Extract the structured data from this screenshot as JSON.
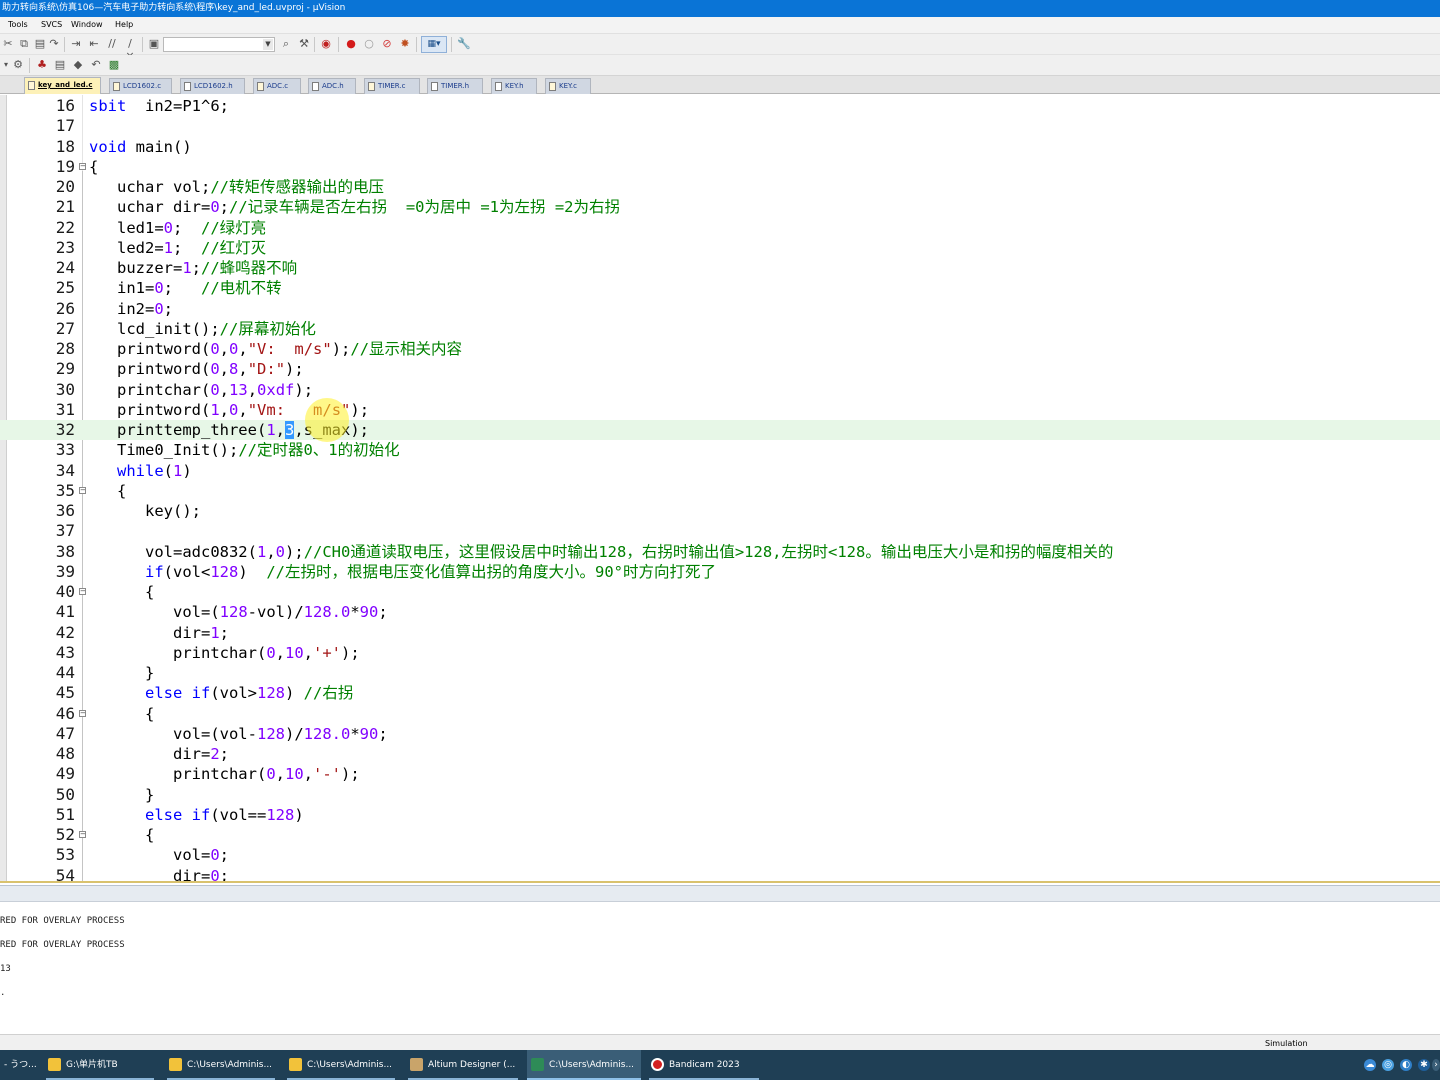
{
  "window": {
    "title": "助力转向系统\\仿真106—汽车电子助力转向系统\\程序\\key_and_led.uvproj - µVision"
  },
  "menu": [
    "Tools",
    "SVCS",
    "Window",
    "Help"
  ],
  "toolbar": {
    "icons": [
      "cut-icon",
      "copy-icon",
      "paste-icon",
      "indent-icon",
      "unindent-icon",
      "comment-icon",
      "uncomment-icon",
      "open-icon",
      "find-icon",
      "debug-icon",
      "breakpoint-icon",
      "insert-breakpoint-icon",
      "kill-breakpoints-icon",
      "target-icon",
      "configure-icon"
    ],
    "target_combo_value": ""
  },
  "tabs": [
    {
      "label": "key_and_led.c",
      "active": true
    },
    {
      "label": "LCD1602.c",
      "active": false
    },
    {
      "label": "LCD1602.h",
      "active": false
    },
    {
      "label": "ADC.c",
      "active": false
    },
    {
      "label": "ADC.h",
      "active": false
    },
    {
      "label": "TIMER.c",
      "active": false
    },
    {
      "label": "TIMER.h",
      "active": false
    },
    {
      "label": "KEY.h",
      "active": false
    },
    {
      "label": "KEY.c",
      "active": false
    }
  ],
  "editor": {
    "current_line": 32,
    "lines": [
      {
        "n": "16",
        "segs": [
          [
            "kw",
            "sbit"
          ],
          [
            "",
            "  in2=P1^6;"
          ]
        ]
      },
      {
        "n": "17",
        "segs": []
      },
      {
        "n": "18",
        "segs": [
          [
            "kw",
            "void"
          ],
          [
            "",
            " main()"
          ]
        ]
      },
      {
        "n": "19",
        "fold": "open",
        "segs": [
          [
            "",
            "{"
          ]
        ]
      },
      {
        "n": "20",
        "segs": [
          [
            "",
            "   uchar vol;"
          ],
          [
            "cm",
            "//转矩传感器输出的电压"
          ]
        ]
      },
      {
        "n": "21",
        "segs": [
          [
            "",
            "   uchar dir="
          ],
          [
            "num",
            "0"
          ],
          [
            "",
            ";"
          ],
          [
            "cm",
            "//记录车辆是否左右拐  =0为居中 =1为左拐 =2为右拐"
          ]
        ]
      },
      {
        "n": "22",
        "segs": [
          [
            "",
            "   led1="
          ],
          [
            "num",
            "0"
          ],
          [
            "",
            ";  "
          ],
          [
            "cm",
            "//绿灯亮"
          ]
        ]
      },
      {
        "n": "23",
        "segs": [
          [
            "",
            "   led2="
          ],
          [
            "num",
            "1"
          ],
          [
            "",
            ";  "
          ],
          [
            "cm",
            "//红灯灭"
          ]
        ]
      },
      {
        "n": "24",
        "segs": [
          [
            "",
            "   buzzer="
          ],
          [
            "num",
            "1"
          ],
          [
            "",
            ";"
          ],
          [
            "cm",
            "//蜂鸣器不响"
          ]
        ]
      },
      {
        "n": "25",
        "segs": [
          [
            "",
            "   in1="
          ],
          [
            "num",
            "0"
          ],
          [
            "",
            ";   "
          ],
          [
            "cm",
            "//电机不转"
          ]
        ]
      },
      {
        "n": "26",
        "segs": [
          [
            "",
            "   in2="
          ],
          [
            "num",
            "0"
          ],
          [
            "",
            ";"
          ]
        ]
      },
      {
        "n": "27",
        "segs": [
          [
            "",
            "   lcd_init();"
          ],
          [
            "cm",
            "//屏幕初始化"
          ]
        ]
      },
      {
        "n": "28",
        "segs": [
          [
            "",
            "   printword("
          ],
          [
            "num",
            "0"
          ],
          [
            "",
            ","
          ],
          [
            "num",
            "0"
          ],
          [
            "",
            ","
          ],
          [
            "str",
            "\"V:  m/s\""
          ],
          [
            "",
            ");"
          ],
          [
            "cm",
            "//显示相关内容"
          ]
        ]
      },
      {
        "n": "29",
        "segs": [
          [
            "",
            "   printword("
          ],
          [
            "num",
            "0"
          ],
          [
            "",
            ","
          ],
          [
            "num",
            "8"
          ],
          [
            "",
            ","
          ],
          [
            "str",
            "\"D:\""
          ],
          [
            "",
            ");"
          ]
        ]
      },
      {
        "n": "30",
        "segs": [
          [
            "",
            "   printchar("
          ],
          [
            "num",
            "0"
          ],
          [
            "",
            ","
          ],
          [
            "num",
            "13"
          ],
          [
            "",
            ","
          ],
          [
            "num",
            "0xdf"
          ],
          [
            "",
            ");"
          ]
        ]
      },
      {
        "n": "31",
        "segs": [
          [
            "",
            "   printword("
          ],
          [
            "num",
            "1"
          ],
          [
            "",
            ","
          ],
          [
            "num",
            "0"
          ],
          [
            "",
            ","
          ],
          [
            "str",
            "\"Vm:   m/s\""
          ],
          [
            "",
            ");"
          ]
        ]
      },
      {
        "n": "32",
        "segs": [
          [
            "",
            "   printtemp_three("
          ],
          [
            "num",
            "1"
          ],
          [
            "",
            ","
          ],
          [
            "sel",
            "3"
          ],
          [
            "",
            ",s_max);"
          ]
        ]
      },
      {
        "n": "33",
        "segs": [
          [
            "",
            "   Time0_Init();"
          ],
          [
            "cm",
            "//定时器0、1的初始化"
          ]
        ]
      },
      {
        "n": "34",
        "segs": [
          [
            "",
            "   "
          ],
          [
            "kw",
            "while"
          ],
          [
            "",
            "("
          ],
          [
            "num",
            "1"
          ],
          [
            "",
            ")"
          ]
        ]
      },
      {
        "n": "35",
        "fold": "open",
        "segs": [
          [
            "",
            "   {"
          ]
        ]
      },
      {
        "n": "36",
        "segs": [
          [
            "",
            "      key();"
          ]
        ]
      },
      {
        "n": "37",
        "segs": []
      },
      {
        "n": "38",
        "segs": [
          [
            "",
            "      vol=adc0832("
          ],
          [
            "num",
            "1"
          ],
          [
            "",
            ","
          ],
          [
            "num",
            "0"
          ],
          [
            "",
            ");"
          ],
          [
            "cm",
            "//CH0通道读取电压，这里假设居中时输出128，右拐时输出值>128,左拐时<128。输出电压大小是和拐的幅度相关的"
          ]
        ]
      },
      {
        "n": "39",
        "segs": [
          [
            "",
            "      "
          ],
          [
            "kw",
            "if"
          ],
          [
            "",
            "(vol<"
          ],
          [
            "num",
            "128"
          ],
          [
            "",
            ")  "
          ],
          [
            "cm",
            "//左拐时，根据电压变化值算出拐的角度大小。90°时方向打死了"
          ]
        ]
      },
      {
        "n": "40",
        "fold": "open",
        "segs": [
          [
            "",
            "      {"
          ]
        ]
      },
      {
        "n": "41",
        "segs": [
          [
            "",
            "         vol=("
          ],
          [
            "num",
            "128"
          ],
          [
            "",
            "-vol)/"
          ],
          [
            "num",
            "128.0"
          ],
          [
            "",
            "*"
          ],
          [
            "num",
            "90"
          ],
          [
            "",
            ";"
          ]
        ]
      },
      {
        "n": "42",
        "segs": [
          [
            "",
            "         dir="
          ],
          [
            "num",
            "1"
          ],
          [
            "",
            ";"
          ]
        ]
      },
      {
        "n": "43",
        "segs": [
          [
            "",
            "         printchar("
          ],
          [
            "num",
            "0"
          ],
          [
            "",
            ","
          ],
          [
            "num",
            "10"
          ],
          [
            "",
            ","
          ],
          [
            "str",
            "'+'"
          ],
          [
            "",
            ");"
          ]
        ]
      },
      {
        "n": "44",
        "segs": [
          [
            "",
            "      }"
          ]
        ]
      },
      {
        "n": "45",
        "segs": [
          [
            "",
            "      "
          ],
          [
            "kw",
            "else if"
          ],
          [
            "",
            "(vol>"
          ],
          [
            "num",
            "128"
          ],
          [
            "",
            ") "
          ],
          [
            "cm",
            "//右拐"
          ]
        ]
      },
      {
        "n": "46",
        "fold": "open",
        "segs": [
          [
            "",
            "      {"
          ]
        ]
      },
      {
        "n": "47",
        "segs": [
          [
            "",
            "         vol=(vol-"
          ],
          [
            "num",
            "128"
          ],
          [
            "",
            ")/"
          ],
          [
            "num",
            "128.0"
          ],
          [
            "",
            "*"
          ],
          [
            "num",
            "90"
          ],
          [
            "",
            ";"
          ]
        ]
      },
      {
        "n": "48",
        "segs": [
          [
            "",
            "         dir="
          ],
          [
            "num",
            "2"
          ],
          [
            "",
            ";"
          ]
        ]
      },
      {
        "n": "49",
        "segs": [
          [
            "",
            "         printchar("
          ],
          [
            "num",
            "0"
          ],
          [
            "",
            ","
          ],
          [
            "num",
            "10"
          ],
          [
            "",
            ","
          ],
          [
            "str",
            "'-'"
          ],
          [
            "",
            ");"
          ]
        ]
      },
      {
        "n": "50",
        "segs": [
          [
            "",
            "      }"
          ]
        ]
      },
      {
        "n": "51",
        "segs": [
          [
            "",
            "      "
          ],
          [
            "kw",
            "else if"
          ],
          [
            "",
            "(vol=="
          ],
          [
            "num",
            "128"
          ],
          [
            "",
            ")"
          ]
        ]
      },
      {
        "n": "52",
        "fold": "open",
        "segs": [
          [
            "",
            "      {"
          ]
        ]
      },
      {
        "n": "53",
        "segs": [
          [
            "",
            "         vol="
          ],
          [
            "num",
            "0"
          ],
          [
            "",
            ";"
          ]
        ]
      },
      {
        "n": "54",
        "segs": [
          [
            "",
            "         dir="
          ],
          [
            "num",
            "0"
          ],
          [
            "",
            ";"
          ]
        ]
      }
    ]
  },
  "build_output": {
    "lines": [
      "RED FOR OVERLAY PROCESS",
      "RED FOR OVERLAY PROCESS",
      "13",
      "."
    ]
  },
  "statusbar": {
    "mode": "Simulation"
  },
  "taskbar": {
    "items": [
      {
        "label": "- うつ...",
        "icon": "app-icon",
        "active": false
      },
      {
        "label": "G:\\单片机TB",
        "icon": "folder-icon",
        "active": false
      },
      {
        "label": "C:\\Users\\Adminis...",
        "icon": "folder-icon",
        "active": false
      },
      {
        "label": "C:\\Users\\Adminis...",
        "icon": "folder-icon",
        "active": false
      },
      {
        "label": "Altium Designer (...",
        "icon": "altium-icon",
        "active": false
      },
      {
        "label": "C:\\Users\\Adminis...",
        "icon": "keil-icon",
        "active": true
      },
      {
        "label": "Bandicam 2023",
        "icon": "bandicam-icon",
        "active": false
      }
    ]
  },
  "colors": {
    "keyword": "#0000ff",
    "number": "#8000ff",
    "comment": "#008000",
    "string": "#a31515",
    "title_bar": "#0a74d6",
    "current_line": "#e7f7e7",
    "taskbar": "#1f3f55"
  }
}
